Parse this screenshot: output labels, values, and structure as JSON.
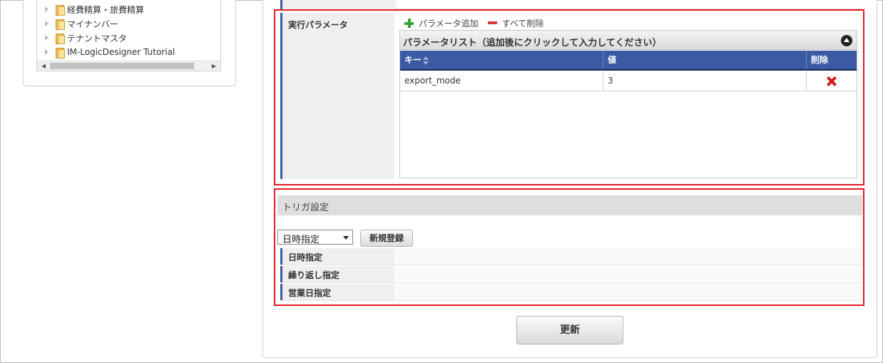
{
  "tree": {
    "items": [
      {
        "label": "経費精算・旅費精算"
      },
      {
        "label": "マイナンバー"
      },
      {
        "label": "テナントマスタ"
      },
      {
        "label": "IM-LogicDesigner Tutorial"
      }
    ]
  },
  "params": {
    "label": "実行パラメータ",
    "add_label": "パラメータ追加",
    "delete_all_label": "すべて削除",
    "list_title": "パラメータリスト（追加後にクリックして入力してください）",
    "columns": {
      "key": "キー",
      "value": "値",
      "delete": "削除"
    },
    "rows": [
      {
        "key": "export_mode",
        "value": "3"
      }
    ]
  },
  "trigger": {
    "title": "トリガ設定",
    "select_value": "日時指定",
    "new_button": "新規登録",
    "rows": [
      {
        "label": "日時指定"
      },
      {
        "label": "繰り返し指定"
      },
      {
        "label": "営業日指定"
      }
    ]
  },
  "update_button": "更新",
  "colors": {
    "accent_blue": "#3b5aa4",
    "highlight_red": "#e31b23",
    "add_green": "#3aa23a",
    "delete_red": "#d01c1c"
  }
}
